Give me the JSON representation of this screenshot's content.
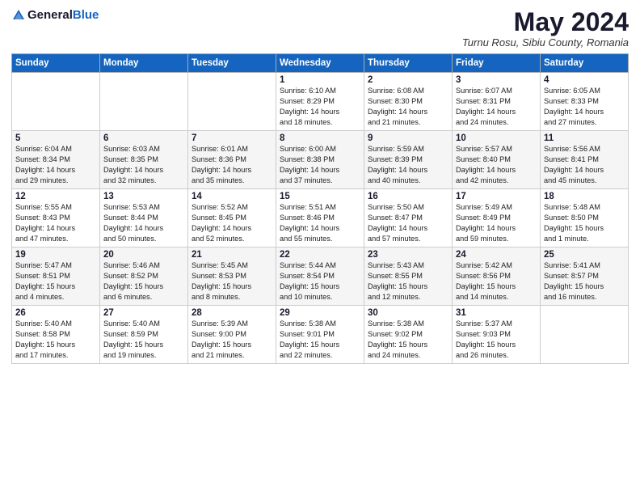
{
  "header": {
    "logo_general": "General",
    "logo_blue": "Blue",
    "month_title": "May 2024",
    "location": "Turnu Rosu, Sibiu County, Romania"
  },
  "weekdays": [
    "Sunday",
    "Monday",
    "Tuesday",
    "Wednesday",
    "Thursday",
    "Friday",
    "Saturday"
  ],
  "weeks": [
    [
      {
        "day": "",
        "info": ""
      },
      {
        "day": "",
        "info": ""
      },
      {
        "day": "",
        "info": ""
      },
      {
        "day": "1",
        "info": "Sunrise: 6:10 AM\nSunset: 8:29 PM\nDaylight: 14 hours\nand 18 minutes."
      },
      {
        "day": "2",
        "info": "Sunrise: 6:08 AM\nSunset: 8:30 PM\nDaylight: 14 hours\nand 21 minutes."
      },
      {
        "day": "3",
        "info": "Sunrise: 6:07 AM\nSunset: 8:31 PM\nDaylight: 14 hours\nand 24 minutes."
      },
      {
        "day": "4",
        "info": "Sunrise: 6:05 AM\nSunset: 8:33 PM\nDaylight: 14 hours\nand 27 minutes."
      }
    ],
    [
      {
        "day": "5",
        "info": "Sunrise: 6:04 AM\nSunset: 8:34 PM\nDaylight: 14 hours\nand 29 minutes."
      },
      {
        "day": "6",
        "info": "Sunrise: 6:03 AM\nSunset: 8:35 PM\nDaylight: 14 hours\nand 32 minutes."
      },
      {
        "day": "7",
        "info": "Sunrise: 6:01 AM\nSunset: 8:36 PM\nDaylight: 14 hours\nand 35 minutes."
      },
      {
        "day": "8",
        "info": "Sunrise: 6:00 AM\nSunset: 8:38 PM\nDaylight: 14 hours\nand 37 minutes."
      },
      {
        "day": "9",
        "info": "Sunrise: 5:59 AM\nSunset: 8:39 PM\nDaylight: 14 hours\nand 40 minutes."
      },
      {
        "day": "10",
        "info": "Sunrise: 5:57 AM\nSunset: 8:40 PM\nDaylight: 14 hours\nand 42 minutes."
      },
      {
        "day": "11",
        "info": "Sunrise: 5:56 AM\nSunset: 8:41 PM\nDaylight: 14 hours\nand 45 minutes."
      }
    ],
    [
      {
        "day": "12",
        "info": "Sunrise: 5:55 AM\nSunset: 8:43 PM\nDaylight: 14 hours\nand 47 minutes."
      },
      {
        "day": "13",
        "info": "Sunrise: 5:53 AM\nSunset: 8:44 PM\nDaylight: 14 hours\nand 50 minutes."
      },
      {
        "day": "14",
        "info": "Sunrise: 5:52 AM\nSunset: 8:45 PM\nDaylight: 14 hours\nand 52 minutes."
      },
      {
        "day": "15",
        "info": "Sunrise: 5:51 AM\nSunset: 8:46 PM\nDaylight: 14 hours\nand 55 minutes."
      },
      {
        "day": "16",
        "info": "Sunrise: 5:50 AM\nSunset: 8:47 PM\nDaylight: 14 hours\nand 57 minutes."
      },
      {
        "day": "17",
        "info": "Sunrise: 5:49 AM\nSunset: 8:49 PM\nDaylight: 14 hours\nand 59 minutes."
      },
      {
        "day": "18",
        "info": "Sunrise: 5:48 AM\nSunset: 8:50 PM\nDaylight: 15 hours\nand 1 minute."
      }
    ],
    [
      {
        "day": "19",
        "info": "Sunrise: 5:47 AM\nSunset: 8:51 PM\nDaylight: 15 hours\nand 4 minutes."
      },
      {
        "day": "20",
        "info": "Sunrise: 5:46 AM\nSunset: 8:52 PM\nDaylight: 15 hours\nand 6 minutes."
      },
      {
        "day": "21",
        "info": "Sunrise: 5:45 AM\nSunset: 8:53 PM\nDaylight: 15 hours\nand 8 minutes."
      },
      {
        "day": "22",
        "info": "Sunrise: 5:44 AM\nSunset: 8:54 PM\nDaylight: 15 hours\nand 10 minutes."
      },
      {
        "day": "23",
        "info": "Sunrise: 5:43 AM\nSunset: 8:55 PM\nDaylight: 15 hours\nand 12 minutes."
      },
      {
        "day": "24",
        "info": "Sunrise: 5:42 AM\nSunset: 8:56 PM\nDaylight: 15 hours\nand 14 minutes."
      },
      {
        "day": "25",
        "info": "Sunrise: 5:41 AM\nSunset: 8:57 PM\nDaylight: 15 hours\nand 16 minutes."
      }
    ],
    [
      {
        "day": "26",
        "info": "Sunrise: 5:40 AM\nSunset: 8:58 PM\nDaylight: 15 hours\nand 17 minutes."
      },
      {
        "day": "27",
        "info": "Sunrise: 5:40 AM\nSunset: 8:59 PM\nDaylight: 15 hours\nand 19 minutes."
      },
      {
        "day": "28",
        "info": "Sunrise: 5:39 AM\nSunset: 9:00 PM\nDaylight: 15 hours\nand 21 minutes."
      },
      {
        "day": "29",
        "info": "Sunrise: 5:38 AM\nSunset: 9:01 PM\nDaylight: 15 hours\nand 22 minutes."
      },
      {
        "day": "30",
        "info": "Sunrise: 5:38 AM\nSunset: 9:02 PM\nDaylight: 15 hours\nand 24 minutes."
      },
      {
        "day": "31",
        "info": "Sunrise: 5:37 AM\nSunset: 9:03 PM\nDaylight: 15 hours\nand 26 minutes."
      },
      {
        "day": "",
        "info": ""
      }
    ]
  ]
}
